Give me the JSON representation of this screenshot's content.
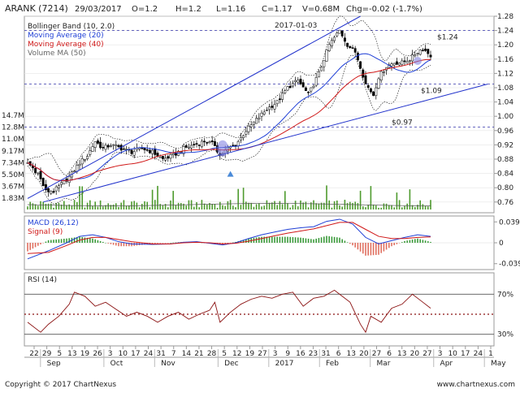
{
  "header": {
    "symbol": "ARANK (7214)",
    "date": "29/03/2017",
    "open": "O=1.2",
    "high": "H=1.2",
    "low": "L=1.16",
    "close": "C=1.17",
    "volume": "V=0.68M",
    "change": "Chg=-0.02 (-1.7%)"
  },
  "copyright": "Copyright © 2017 ChartNexus",
  "website": "www.chartnexus.com",
  "colors": {
    "up_candle": "#ffffff",
    "down_candle": "#000000",
    "ma20": "#1f3fd6",
    "ma40": "#d01818",
    "volume": "#4e9b2e",
    "bollinger": "#000000",
    "macd": "#1f3fd6",
    "signal": "#d01818",
    "hist_pos": "#3a9a3a",
    "hist_neg": "#e07060",
    "rsi": "#8a1010",
    "trendline": "#2233cc",
    "dashed_level": "#3333aa"
  },
  "chart_data": [
    {
      "type": "candlestick",
      "panel": "price",
      "legend": [
        "Bollinger Band (10, 2.0)",
        "Moving Average (20)",
        "Moving Average (40)",
        "Volume MA (50)"
      ],
      "annotation_date": "2017-01-03",
      "level_labels": [
        "$1.24",
        "$1.09",
        "$0.97"
      ],
      "levels": [
        1.24,
        1.09,
        0.97
      ],
      "ylim": [
        0.73,
        1.28
      ],
      "yticks": [
        "1.28",
        "1.24",
        "1.20",
        "1.16",
        "1.12",
        "1.08",
        "1.04",
        "1.00",
        "0.96",
        "0.92",
        "0.88",
        "0.84",
        "0.80",
        "0.76"
      ],
      "volume_ticks": [
        "14.7M",
        "12.8M",
        "11.0M",
        "9.17M",
        "7.34M",
        "5.50M",
        "3.67M",
        "1.83M"
      ],
      "close_points": [
        [
          0,
          0.87
        ],
        [
          4,
          0.84
        ],
        [
          7,
          0.79
        ],
        [
          10,
          0.79
        ],
        [
          13,
          0.81
        ],
        [
          16,
          0.83
        ],
        [
          20,
          0.87
        ],
        [
          23,
          0.89
        ],
        [
          26,
          0.93
        ],
        [
          29,
          0.91
        ],
        [
          32,
          0.92
        ],
        [
          36,
          0.91
        ],
        [
          40,
          0.9
        ],
        [
          44,
          0.91
        ],
        [
          48,
          0.9
        ],
        [
          52,
          0.88
        ],
        [
          56,
          0.89
        ],
        [
          60,
          0.91
        ],
        [
          64,
          0.92
        ],
        [
          68,
          0.93
        ],
        [
          72,
          0.92
        ],
        [
          74,
          0.89
        ],
        [
          77,
          0.91
        ],
        [
          80,
          0.92
        ],
        [
          84,
          0.96
        ],
        [
          88,
          0.99
        ],
        [
          92,
          1.02
        ],
        [
          96,
          1.04
        ],
        [
          100,
          1.08
        ],
        [
          104,
          1.1
        ],
        [
          108,
          1.06
        ],
        [
          112,
          1.12
        ],
        [
          116,
          1.2
        ],
        [
          120,
          1.24
        ],
        [
          123,
          1.2
        ],
        [
          126,
          1.18
        ],
        [
          128,
          1.14
        ],
        [
          130,
          1.09
        ],
        [
          133,
          1.06
        ],
        [
          135,
          1.11
        ],
        [
          138,
          1.14
        ],
        [
          141,
          1.15
        ],
        [
          144,
          1.15
        ],
        [
          147,
          1.16
        ],
        [
          150,
          1.18
        ],
        [
          152,
          1.19
        ],
        [
          155,
          1.17
        ]
      ]
    },
    {
      "type": "line",
      "panel": "macd",
      "title": "MACD (26,12)",
      "series_label": "Signal (9)",
      "yticks": [
        "0.039",
        "0",
        "-0.039"
      ],
      "macd_points": [
        [
          0,
          -0.03
        ],
        [
          8,
          -0.015
        ],
        [
          15,
          0.0
        ],
        [
          20,
          0.012
        ],
        [
          25,
          0.015
        ],
        [
          30,
          0.01
        ],
        [
          35,
          0.002
        ],
        [
          40,
          -0.002
        ],
        [
          48,
          -0.003
        ],
        [
          55,
          -0.002
        ],
        [
          60,
          0.001
        ],
        [
          65,
          0.002
        ],
        [
          70,
          -0.001
        ],
        [
          75,
          -0.004
        ],
        [
          80,
          0.0
        ],
        [
          85,
          0.008
        ],
        [
          90,
          0.015
        ],
        [
          95,
          0.02
        ],
        [
          100,
          0.025
        ],
        [
          105,
          0.028
        ],
        [
          110,
          0.03
        ],
        [
          115,
          0.04
        ],
        [
          120,
          0.044
        ],
        [
          125,
          0.035
        ],
        [
          130,
          0.01
        ],
        [
          135,
          -0.002
        ],
        [
          140,
          0.004
        ],
        [
          145,
          0.01
        ],
        [
          150,
          0.015
        ],
        [
          155,
          0.012
        ]
      ],
      "signal_points": [
        [
          0,
          -0.02
        ],
        [
          8,
          -0.018
        ],
        [
          15,
          -0.005
        ],
        [
          20,
          0.005
        ],
        [
          25,
          0.01
        ],
        [
          30,
          0.01
        ],
        [
          35,
          0.006
        ],
        [
          40,
          0.002
        ],
        [
          48,
          -0.002
        ],
        [
          55,
          -0.002
        ],
        [
          60,
          0.0
        ],
        [
          65,
          0.001
        ],
        [
          70,
          0.0
        ],
        [
          75,
          -0.002
        ],
        [
          80,
          -0.001
        ],
        [
          85,
          0.003
        ],
        [
          90,
          0.008
        ],
        [
          95,
          0.013
        ],
        [
          100,
          0.018
        ],
        [
          105,
          0.022
        ],
        [
          110,
          0.026
        ],
        [
          115,
          0.032
        ],
        [
          120,
          0.038
        ],
        [
          125,
          0.038
        ],
        [
          130,
          0.025
        ],
        [
          135,
          0.012
        ],
        [
          140,
          0.008
        ],
        [
          145,
          0.008
        ],
        [
          150,
          0.01
        ],
        [
          155,
          0.011
        ]
      ]
    },
    {
      "type": "line",
      "panel": "rsi",
      "title": "RSI (14)",
      "yticks": [
        "70%",
        "30%"
      ],
      "levels": [
        70,
        50,
        30
      ],
      "points": [
        [
          0,
          42
        ],
        [
          5,
          32
        ],
        [
          8,
          40
        ],
        [
          12,
          48
        ],
        [
          16,
          60
        ],
        [
          18,
          72
        ],
        [
          22,
          68
        ],
        [
          26,
          58
        ],
        [
          30,
          62
        ],
        [
          34,
          55
        ],
        [
          38,
          48
        ],
        [
          42,
          52
        ],
        [
          46,
          48
        ],
        [
          50,
          42
        ],
        [
          54,
          48
        ],
        [
          58,
          52
        ],
        [
          62,
          45
        ],
        [
          66,
          50
        ],
        [
          70,
          54
        ],
        [
          72,
          62
        ],
        [
          74,
          42
        ],
        [
          78,
          52
        ],
        [
          82,
          60
        ],
        [
          86,
          65
        ],
        [
          90,
          68
        ],
        [
          94,
          66
        ],
        [
          98,
          70
        ],
        [
          102,
          72
        ],
        [
          106,
          58
        ],
        [
          110,
          66
        ],
        [
          114,
          68
        ],
        [
          118,
          74
        ],
        [
          120,
          70
        ],
        [
          124,
          62
        ],
        [
          128,
          40
        ],
        [
          130,
          32
        ],
        [
          132,
          48
        ],
        [
          136,
          42
        ],
        [
          140,
          56
        ],
        [
          144,
          60
        ],
        [
          148,
          70
        ],
        [
          152,
          62
        ],
        [
          155,
          56
        ]
      ]
    }
  ],
  "x_axis": {
    "day_ticks": [
      "22",
      "29",
      "5",
      "13",
      "19",
      "26",
      "3",
      "10",
      "17",
      "24",
      "31",
      "7",
      "14",
      "21",
      "28",
      "5",
      "12",
      "19",
      "27",
      "3",
      "9",
      "16",
      "23",
      "31",
      "6",
      "13",
      "20",
      "27",
      "6",
      "13",
      "20",
      "27",
      "3",
      "10",
      "17",
      "24",
      "1"
    ],
    "month_labels": [
      "Sep",
      "Oct",
      "Nov",
      "Dec",
      "2017",
      "Feb",
      "Mar",
      "Apr",
      "May"
    ]
  }
}
